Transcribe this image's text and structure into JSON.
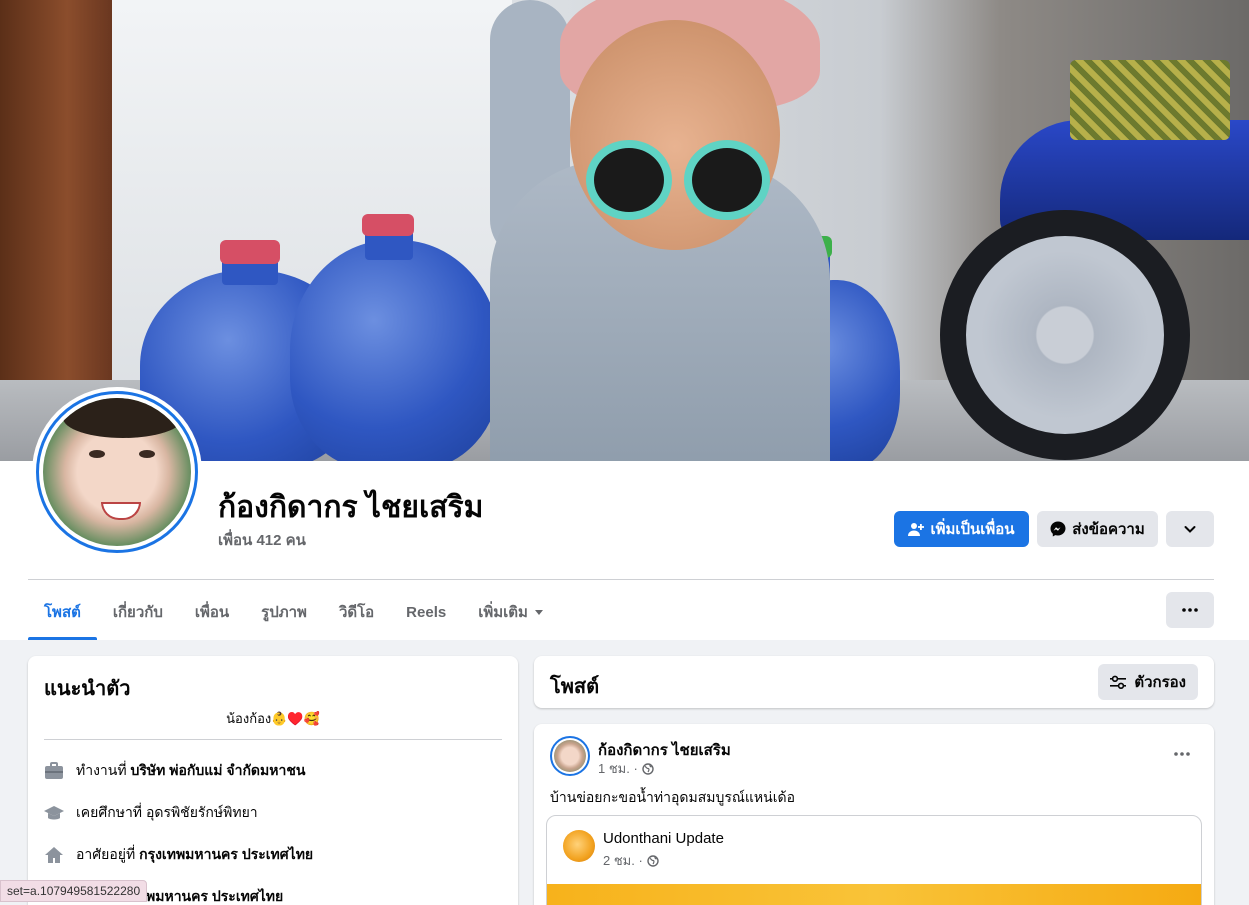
{
  "profile": {
    "name": "ก้องกิดากร ไชยเสริม",
    "friends": "เพื่อน 412 คน"
  },
  "actions": {
    "add_friend": "เพิ่มเป็นเพื่อน",
    "message": "ส่งข้อความ"
  },
  "tabs": [
    "โพสต์",
    "เกี่ยวกับ",
    "เพื่อน",
    "รูปภาพ",
    "วิดีโอ",
    "Reels",
    "เพิ่มเติม"
  ],
  "intro": {
    "title": "แนะนำตัว",
    "bio": "น้องก้อง👶♥️🥰",
    "work_prefix": "ทำงานที่",
    "work": "บริษัท พ่อกับแม่ จำกัดมหาชน",
    "edu_prefix": "เคยศึกษาที่",
    "edu": "อุดรพิชัยรักษ์พิทยา",
    "lives_prefix": "อาศัยอยู่ที่",
    "lives": "กรุงเทพมหานคร ประเทศไทย",
    "from": "เทพมหานคร ประเทศไทย"
  },
  "posts": {
    "title": "โพสต์",
    "filter": "ตัวกรอง",
    "item": {
      "author": "ก้องกิดากร ไชยเสริม",
      "time": "1 ชม. ·",
      "text": "บ้านข่อยกะขอน้ำท่าอุดมสมบูรณ์แหน่เด้อ",
      "shared_page": "Udonthani Update",
      "shared_time": "2 ชม. ·"
    }
  },
  "status_bar": "set=a.107949581522280",
  "colors": {
    "accent": "#1b74e4",
    "bg": "#f0f2f5"
  }
}
